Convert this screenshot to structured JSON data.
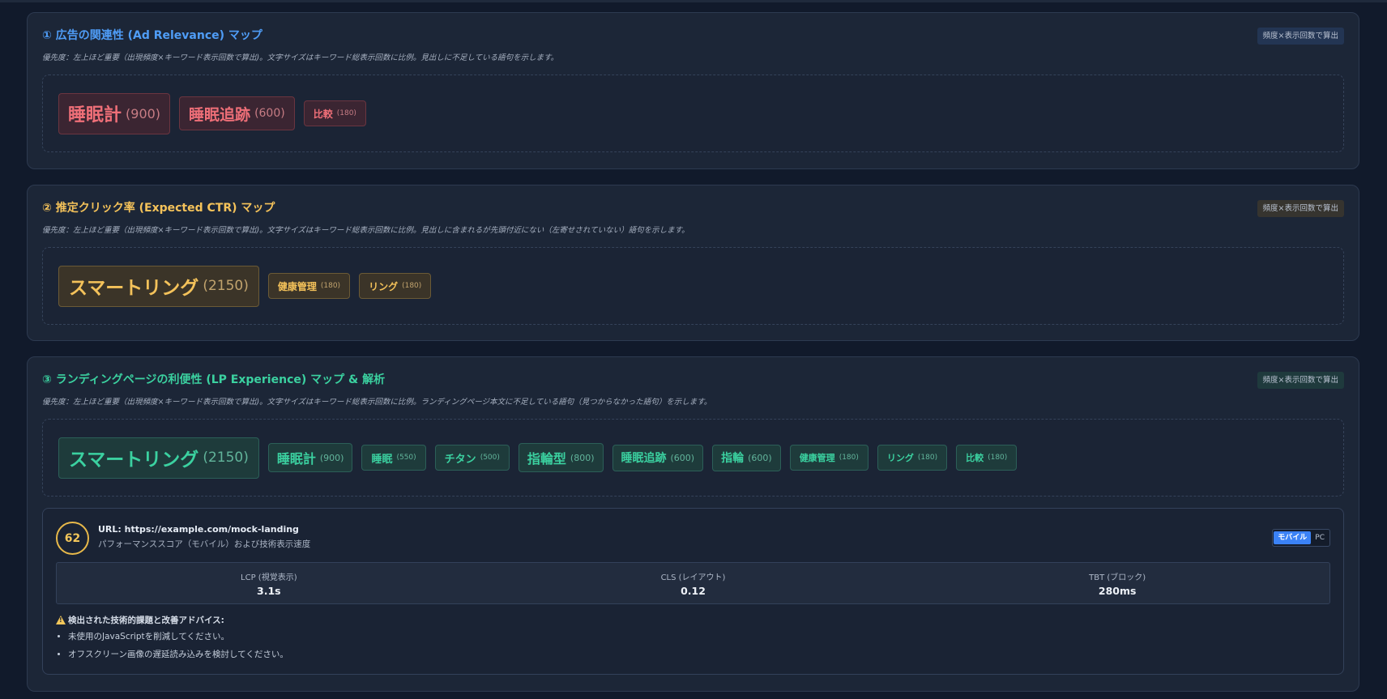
{
  "sections": [
    {
      "title": "① 広告の関連性 (Ad Relevance) マップ",
      "badge": "頻度×表示回数で算出",
      "desc": "優先度：左上ほど重要（出現頻度×キーワード表示回数で算出)。文字サイズはキーワード総表示回数に比例。見出しに不足している語句を示します。",
      "color": "#4f9df7",
      "chips": [
        {
          "word": "睡眠計",
          "count": "(900)"
        },
        {
          "word": "睡眠追跡",
          "count": "(600)"
        },
        {
          "word": "比較",
          "count": "(180)"
        }
      ]
    },
    {
      "title": "② 推定クリック率 (Expected CTR) マップ",
      "badge": "頻度×表示回数で算出",
      "desc": "優先度：左上ほど重要（出現頻度×キーワード表示回数で算出)。文字サイズはキーワード総表示回数に比例。見出しに含まれるが先頭付近にない（左寄せされていない）語句を示します。",
      "color": "#f4c25a",
      "chips": [
        {
          "word": "スマートリング",
          "count": "(2150)"
        },
        {
          "word": "健康管理",
          "count": "(180)"
        },
        {
          "word": "リング",
          "count": "(180)"
        }
      ]
    },
    {
      "title": "③ ランディングページの利便性 (LP Experience) マップ & 解析",
      "badge": "頻度×表示回数で算出",
      "desc": "優先度：左上ほど重要（出現頻度×キーワード表示回数で算出)。文字サイズはキーワード総表示回数に比例。ランディングページ本文に不足している語句（見つからなかった語句）を示します。",
      "color": "#3bd1a0",
      "chips": [
        {
          "word": "スマートリング",
          "count": "(2150)"
        },
        {
          "word": "睡眠計",
          "count": "(900)"
        },
        {
          "word": "睡眠",
          "count": "(550)"
        },
        {
          "word": "チタン",
          "count": "(500)"
        },
        {
          "word": "指輪型",
          "count": "(800)"
        },
        {
          "word": "睡眠追跡",
          "count": "(600)"
        },
        {
          "word": "指輪",
          "count": "(600)"
        },
        {
          "word": "健康管理",
          "count": "(180)"
        },
        {
          "word": "リング",
          "count": "(180)"
        },
        {
          "word": "比較",
          "count": "(180)"
        }
      ]
    }
  ],
  "performance": {
    "score": "62",
    "url": "URL: https://example.com/mock-landing",
    "subtitle": "パフォーマンススコア（モバイル）および技術表示速度",
    "toggle": {
      "mobile": "モバイル",
      "pc": "PC",
      "selected": "mobile"
    },
    "metrics": [
      {
        "label": "LCP (視覚表示)",
        "value": "3.1s"
      },
      {
        "label": "CLS (レイアウト)",
        "value": "0.12"
      },
      {
        "label": "TBT (ブロック)",
        "value": "280ms"
      }
    ],
    "advice_title": "検出された技術的課題と改善アドバイス:",
    "advice": [
      "未使用のJavaScriptを削減してください。",
      "オフスクリーン画像の遅延読み込みを検討してください。"
    ]
  }
}
